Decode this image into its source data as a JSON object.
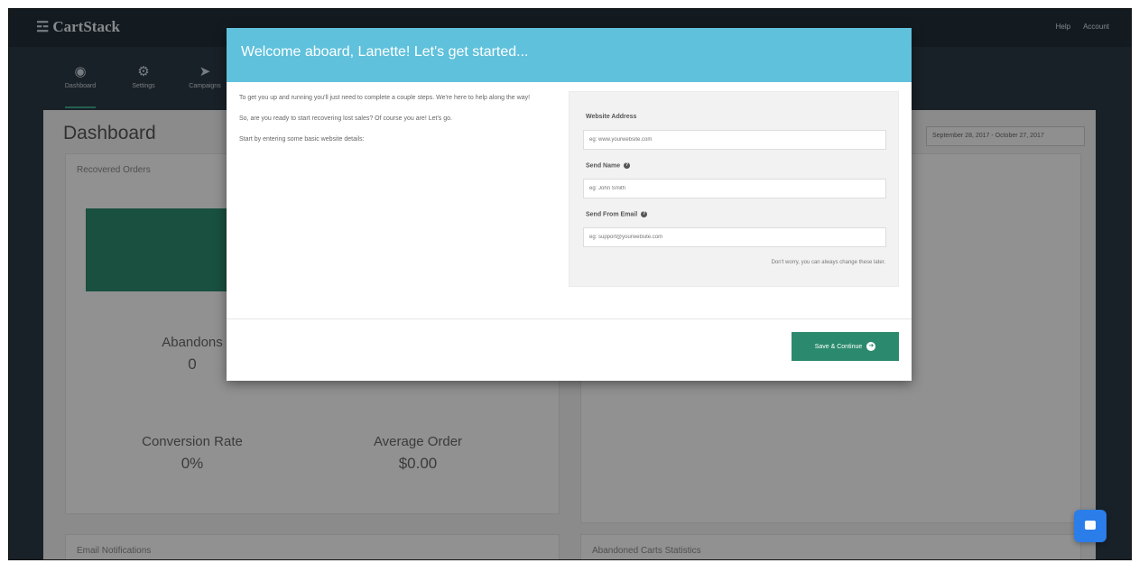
{
  "app": {
    "logo": "CartStack",
    "top_right": [
      "Help",
      "Account"
    ]
  },
  "nav": [
    {
      "label": "Dashboard",
      "icon": "dashboard-icon"
    },
    {
      "label": "Settings",
      "icon": "gears-icon"
    },
    {
      "label": "Campaigns",
      "icon": "megaphone-icon"
    }
  ],
  "dashboard": {
    "title": "Dashboard",
    "date_range": "September 28, 2017 - October 27, 2017",
    "card_title": "Recovered Orders",
    "abandoned_label": "Abandons",
    "abandoned_value": "0",
    "conversion_label": "Conversion Rate",
    "conversion_value": "0%",
    "average_label": "Average Order",
    "average_value": "$0.00",
    "bottom_left_title": "Email Notifications",
    "bottom_right_title": "Abandoned Carts Statistics"
  },
  "modal": {
    "title": "Welcome aboard, Lanette! Let's get started...",
    "intro": [
      "To get you up and running you'll just need to complete a couple steps. We're here to help along the way!",
      "So, are you ready to start recovering lost sales? Of course you are! Let's go.",
      "Start by entering some basic website details:"
    ],
    "website_label": "Website Address",
    "website_placeholder": "eg: www.yourwebsite.com",
    "send_name_label": "Send Name",
    "send_name_placeholder": "eg: John Smith",
    "send_email_label": "Send From Email",
    "send_email_placeholder": "eg: support@yourwebsite.com",
    "note": "Don't worry, you can always change these later.",
    "save_button": "Save & Continue"
  },
  "colors": {
    "accent_green": "#2b8a6d",
    "header_blue": "#5fc1dc",
    "chat_blue": "#2b7de9"
  }
}
